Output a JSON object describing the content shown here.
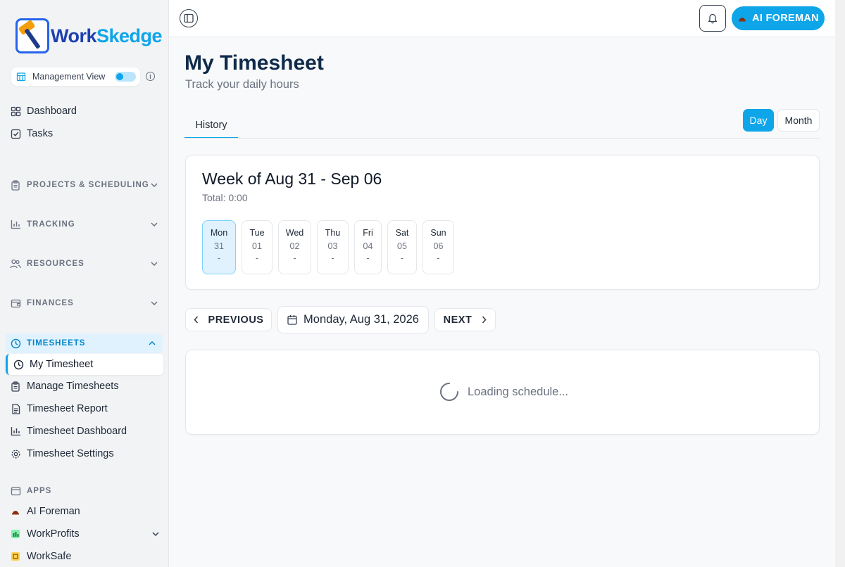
{
  "brand": {
    "name_part1": "Work",
    "name_part2": "Skedge"
  },
  "management": {
    "label": "Management View",
    "enabled": true
  },
  "sidebar": {
    "top_items": [
      {
        "label": "Dashboard",
        "icon": "grid-icon"
      },
      {
        "label": "Tasks",
        "icon": "check-square-icon"
      }
    ],
    "sections": {
      "projects": "PROJECTS & SCHEDULING",
      "tracking": "TRACKING",
      "resources": "RESOURCES",
      "finances": "FINANCES",
      "timesheets": "TIMESHEETS",
      "apps": "APPS"
    },
    "timesheet_items": [
      {
        "label": "My Timesheet",
        "icon": "clock-icon",
        "active": true
      },
      {
        "label": "Manage Timesheets",
        "icon": "clipboard-icon"
      },
      {
        "label": "Timesheet Report",
        "icon": "file-icon"
      },
      {
        "label": "Timesheet Dashboard",
        "icon": "bar-chart-icon"
      },
      {
        "label": "Timesheet Settings",
        "icon": "gear-icon"
      }
    ],
    "app_items": [
      {
        "label": "AI Foreman",
        "icon": "hard-hat-icon"
      },
      {
        "label": "WorkProfits",
        "icon": "app-icon"
      },
      {
        "label": "WorkSafe",
        "icon": "app-icon"
      }
    ]
  },
  "topbar": {
    "ai_button": "AI FOREMAN"
  },
  "page": {
    "title": "My Timesheet",
    "subtitle": "Track your daily hours",
    "tab_history": "History",
    "view_day": "Day",
    "view_month": "Month"
  },
  "week": {
    "title": "Week of Aug 31 - Sep 06",
    "total": "Total: 0:00",
    "days": [
      {
        "name": "Mon",
        "date": "31",
        "hours": "-",
        "active": true
      },
      {
        "name": "Tue",
        "date": "01",
        "hours": "-"
      },
      {
        "name": "Wed",
        "date": "02",
        "hours": "-"
      },
      {
        "name": "Thu",
        "date": "03",
        "hours": "-"
      },
      {
        "name": "Fri",
        "date": "04",
        "hours": "-"
      },
      {
        "name": "Sat",
        "date": "05",
        "hours": "-"
      },
      {
        "name": "Sun",
        "date": "06",
        "hours": "-"
      }
    ]
  },
  "date_nav": {
    "previous": "PREVIOUS",
    "current_date": "Monday, Aug 31, 2026",
    "next": "NEXT"
  },
  "loading_text": "Loading schedule...",
  "colors": {
    "accent": "#0ea5e9",
    "title": "#0f2a4a"
  }
}
